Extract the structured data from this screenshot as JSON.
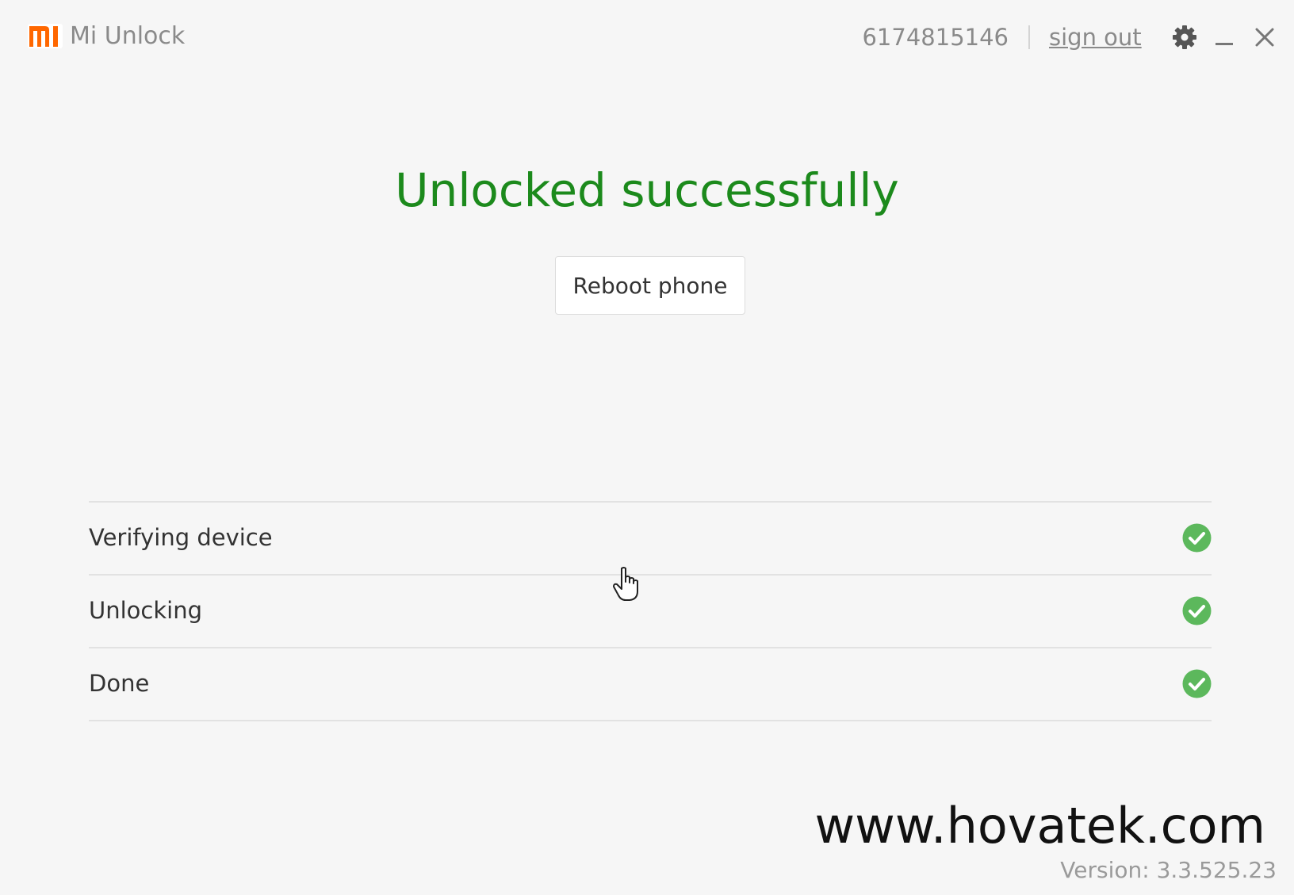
{
  "titlebar": {
    "logo_text": "mi",
    "app_name": "Mi Unlock",
    "account_id": "6174815146",
    "sign_out_label": "sign out"
  },
  "main": {
    "headline": "Unlocked successfully",
    "reboot_label": "Reboot phone"
  },
  "steps": [
    {
      "label": "Verifying device",
      "status": "complete"
    },
    {
      "label": "Unlocking",
      "status": "complete"
    },
    {
      "label": "Done",
      "status": "complete"
    }
  ],
  "footer": {
    "watermark": "www.hovatek.com",
    "version": "Version: 3.3.525.23"
  },
  "colors": {
    "brand": "#ff6700",
    "success_text": "#1c8a1c",
    "check_green": "#5cb85c"
  },
  "icons": {
    "logo": "mi-logo-icon",
    "settings": "gear-icon",
    "minimize": "minimize-icon",
    "close": "close-icon",
    "check": "check-circle-icon",
    "cursor": "hand-cursor-icon"
  }
}
